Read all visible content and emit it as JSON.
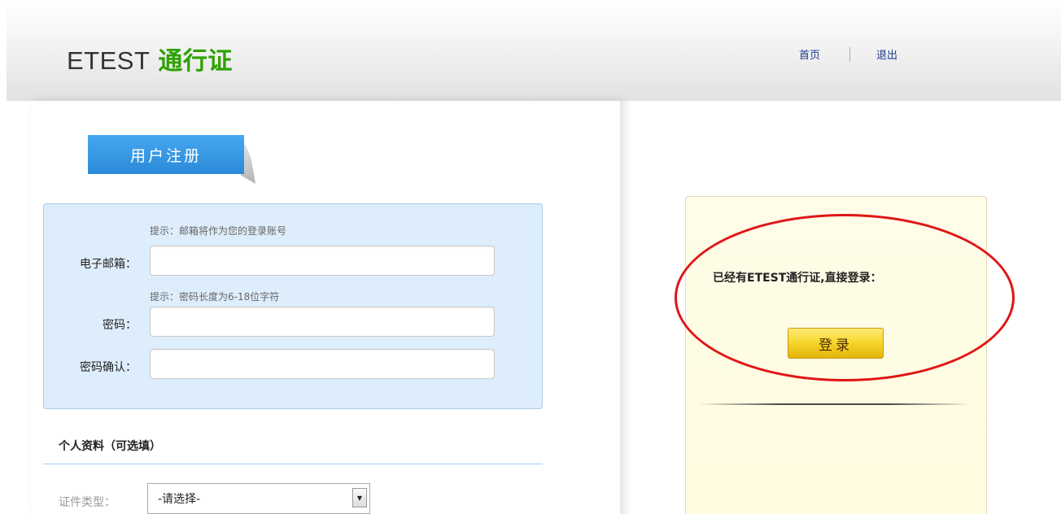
{
  "header": {
    "brand_prefix": "ETEST",
    "brand_suffix": "通行证",
    "nav": {
      "home": "首页",
      "logout": "退出"
    }
  },
  "register": {
    "tab_title": "用户注册",
    "email_hint": "提示：邮箱将作为您的登录账号",
    "email_label": "电子邮箱：",
    "email_value": "",
    "password_hint": "提示：密码长度为6-18位字符",
    "password_label": "密码：",
    "password_value": "",
    "confirm_label": "密码确认：",
    "confirm_value": ""
  },
  "personal": {
    "title": "个人资料（可选填）",
    "id_type_label": "证件类型：",
    "id_type_selected": "-请选择-"
  },
  "login": {
    "prompt": "已经有ETEST通行证,直接登录：",
    "button": "登录"
  },
  "colors": {
    "brand_green": "#2ea100",
    "tab_blue": "#2b8ad8",
    "form_bg": "#deedfb",
    "login_button": "#f6d52a",
    "annotation_red": "#e01515"
  }
}
